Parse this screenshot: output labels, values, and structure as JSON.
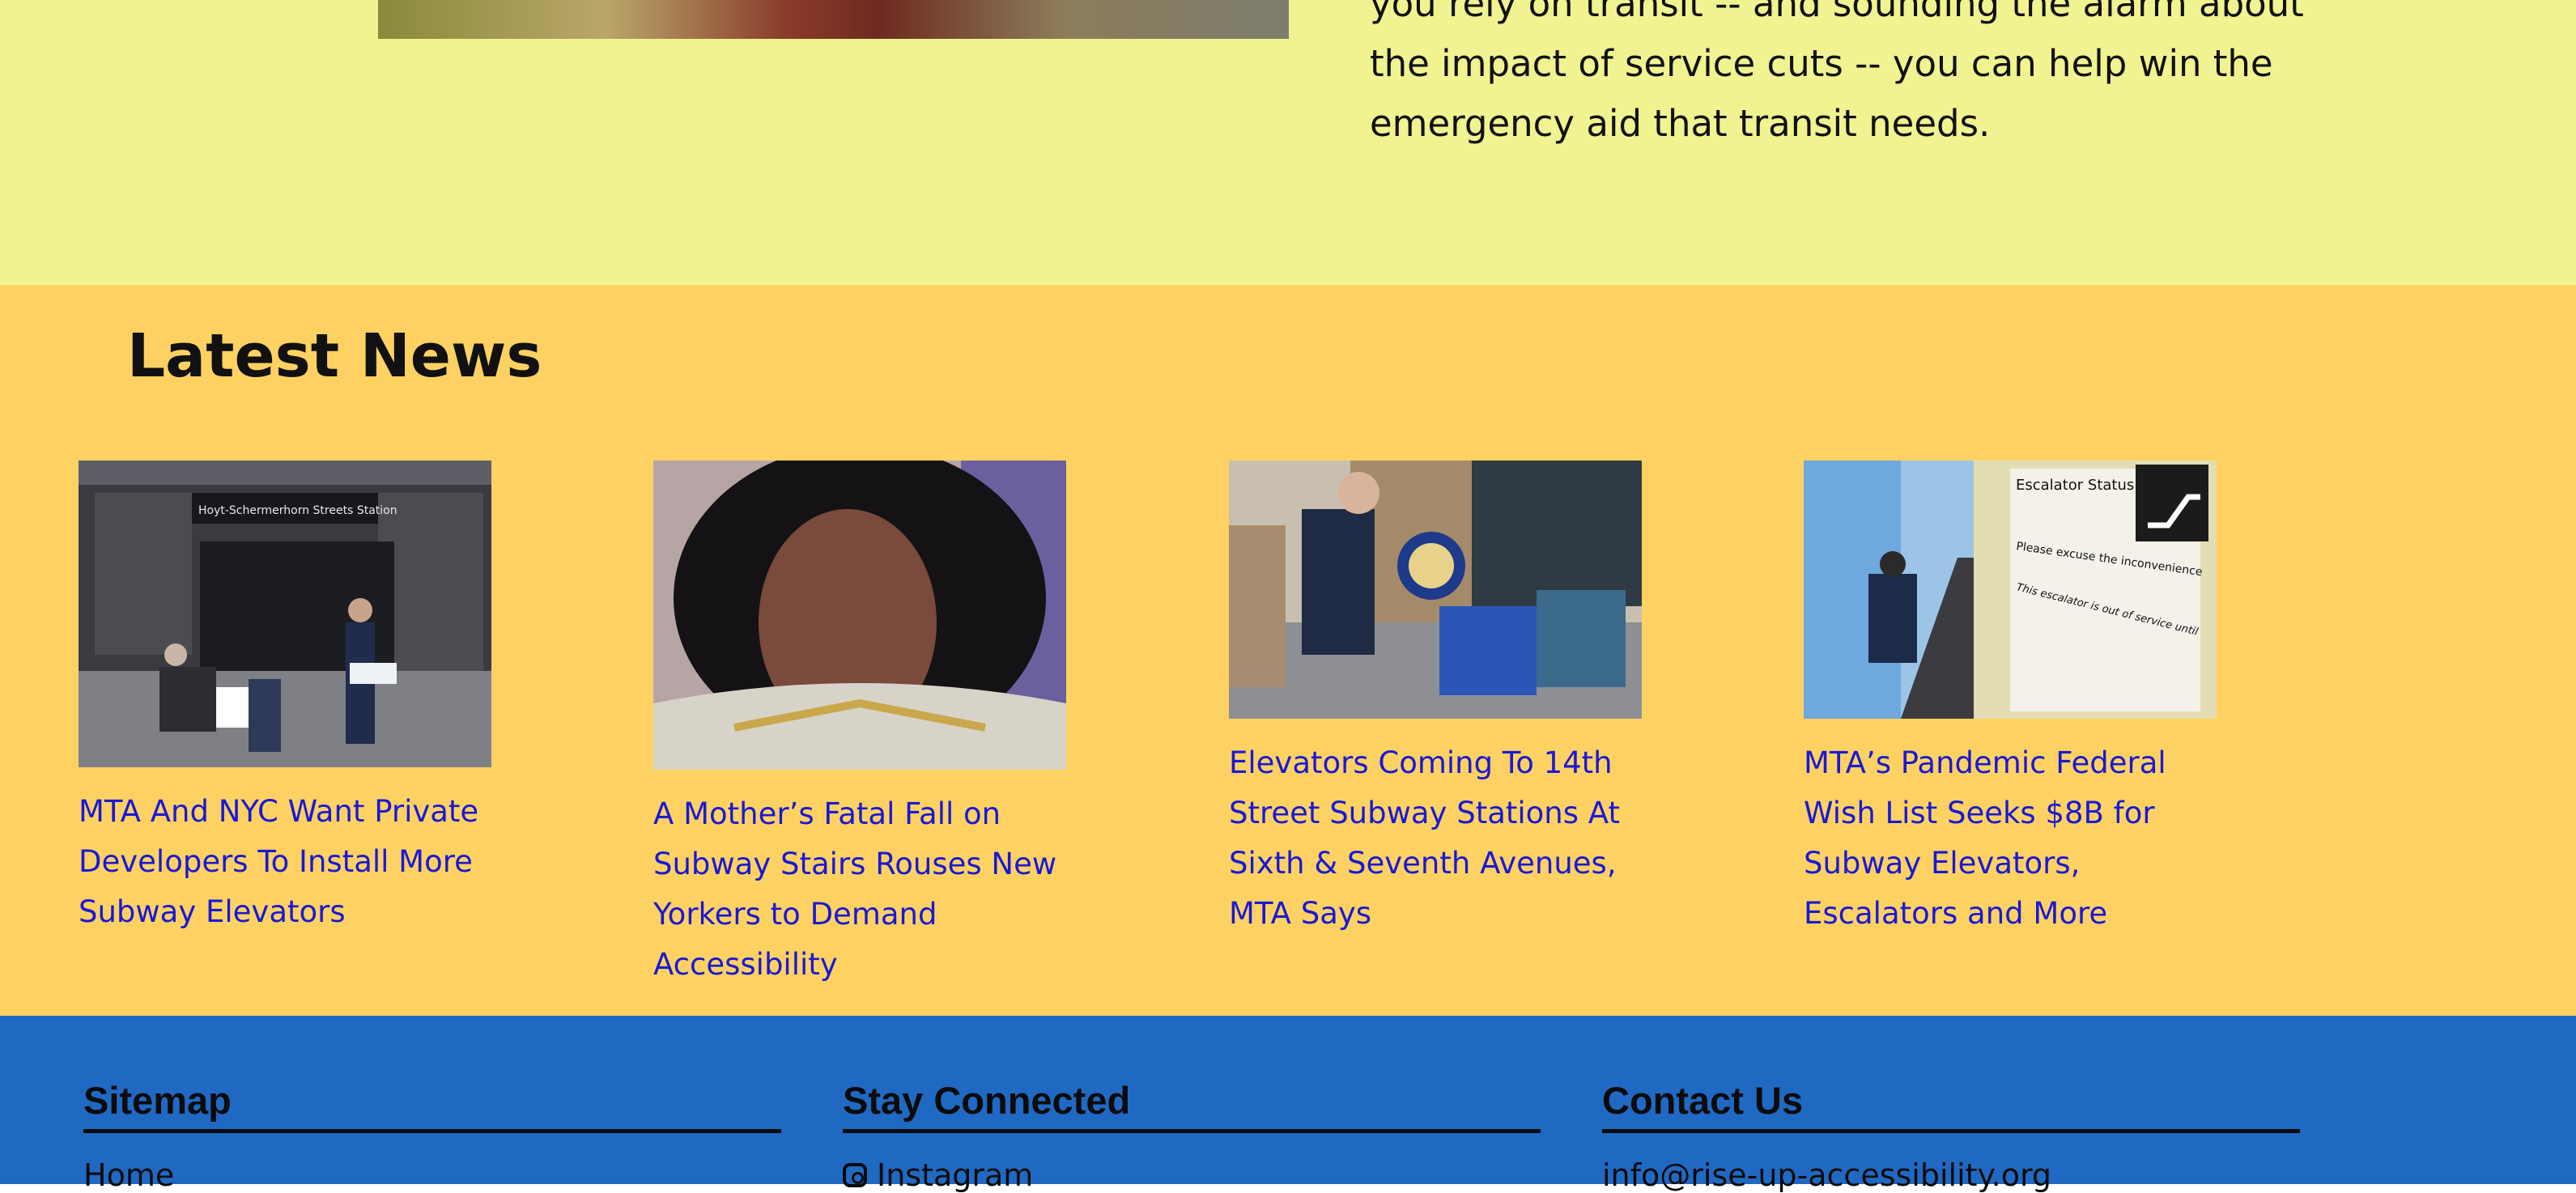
{
  "hero": {
    "lines": [
      "you rely on transit -- and sounding the alarm about",
      "the impact of service cuts -- you can help win the",
      "emergency aid that transit needs."
    ]
  },
  "news": {
    "title": "Latest News",
    "articles": [
      {
        "headline": "MTA And NYC Want Private Developers To Install More Subway Elevators",
        "image_sign": "Hoyt-Schermerhorn Streets Station"
      },
      {
        "headline": "A Mother’s Fatal Fall on Subway Stairs Rouses New Yorkers to Demand Accessibility"
      },
      {
        "headline": "Elevators Coming To 14th Street Subway Stations At Sixth & Seventh Avenues, MTA Says"
      },
      {
        "headline": "MTA’s Pandemic Federal Wish List Seeks $8B for Subway Elevators, Escalators and More",
        "image_sign": [
          "Escalator Status",
          "Please excuse the inconvenience",
          "This escalator is out of service until"
        ]
      }
    ]
  },
  "footer": {
    "sitemap_title": "Sitemap",
    "sitemap_peek": "Home",
    "connected_title": "Stay Connected",
    "connected_peek": "Instagram",
    "contact_title": "Contact Us",
    "contact_peek": "info@rise-up-accessibility.org"
  },
  "colors": {
    "top_band": "#f1f391",
    "news_band": "#fed262",
    "footer_band": "#2069c3",
    "link": "#1a18d6"
  }
}
